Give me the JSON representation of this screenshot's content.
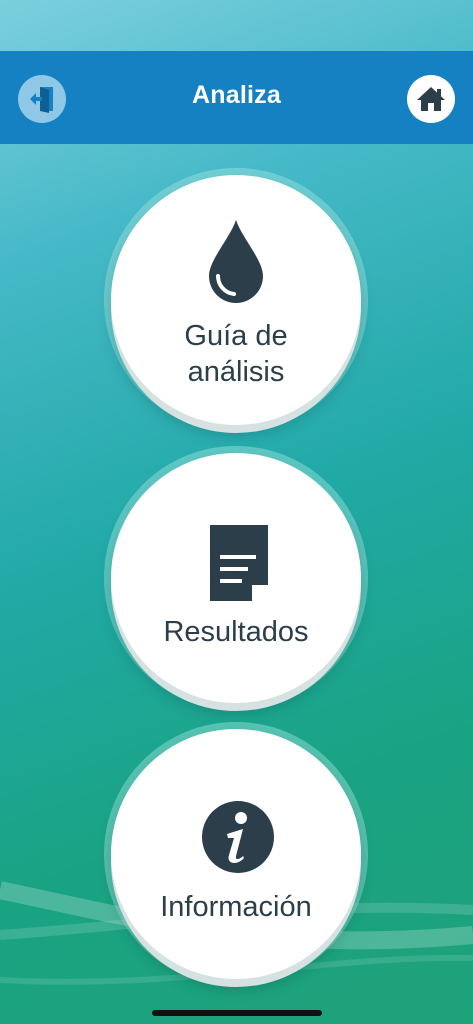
{
  "header": {
    "title": "Analiza",
    "exit_icon": "exit-door-icon",
    "home_icon": "home-icon"
  },
  "menu": [
    {
      "id": "guide",
      "label": "Guía de análisis",
      "icon": "water-drop-icon"
    },
    {
      "id": "results",
      "label": "Resultados",
      "icon": "document-icon"
    },
    {
      "id": "info",
      "label": "Información",
      "icon": "info-icon"
    }
  ],
  "colors": {
    "header_bg": "#1580c2",
    "icon_dark": "#2c3e4a",
    "background_start": "#7ccfdd",
    "background_end": "#1ea27a"
  }
}
